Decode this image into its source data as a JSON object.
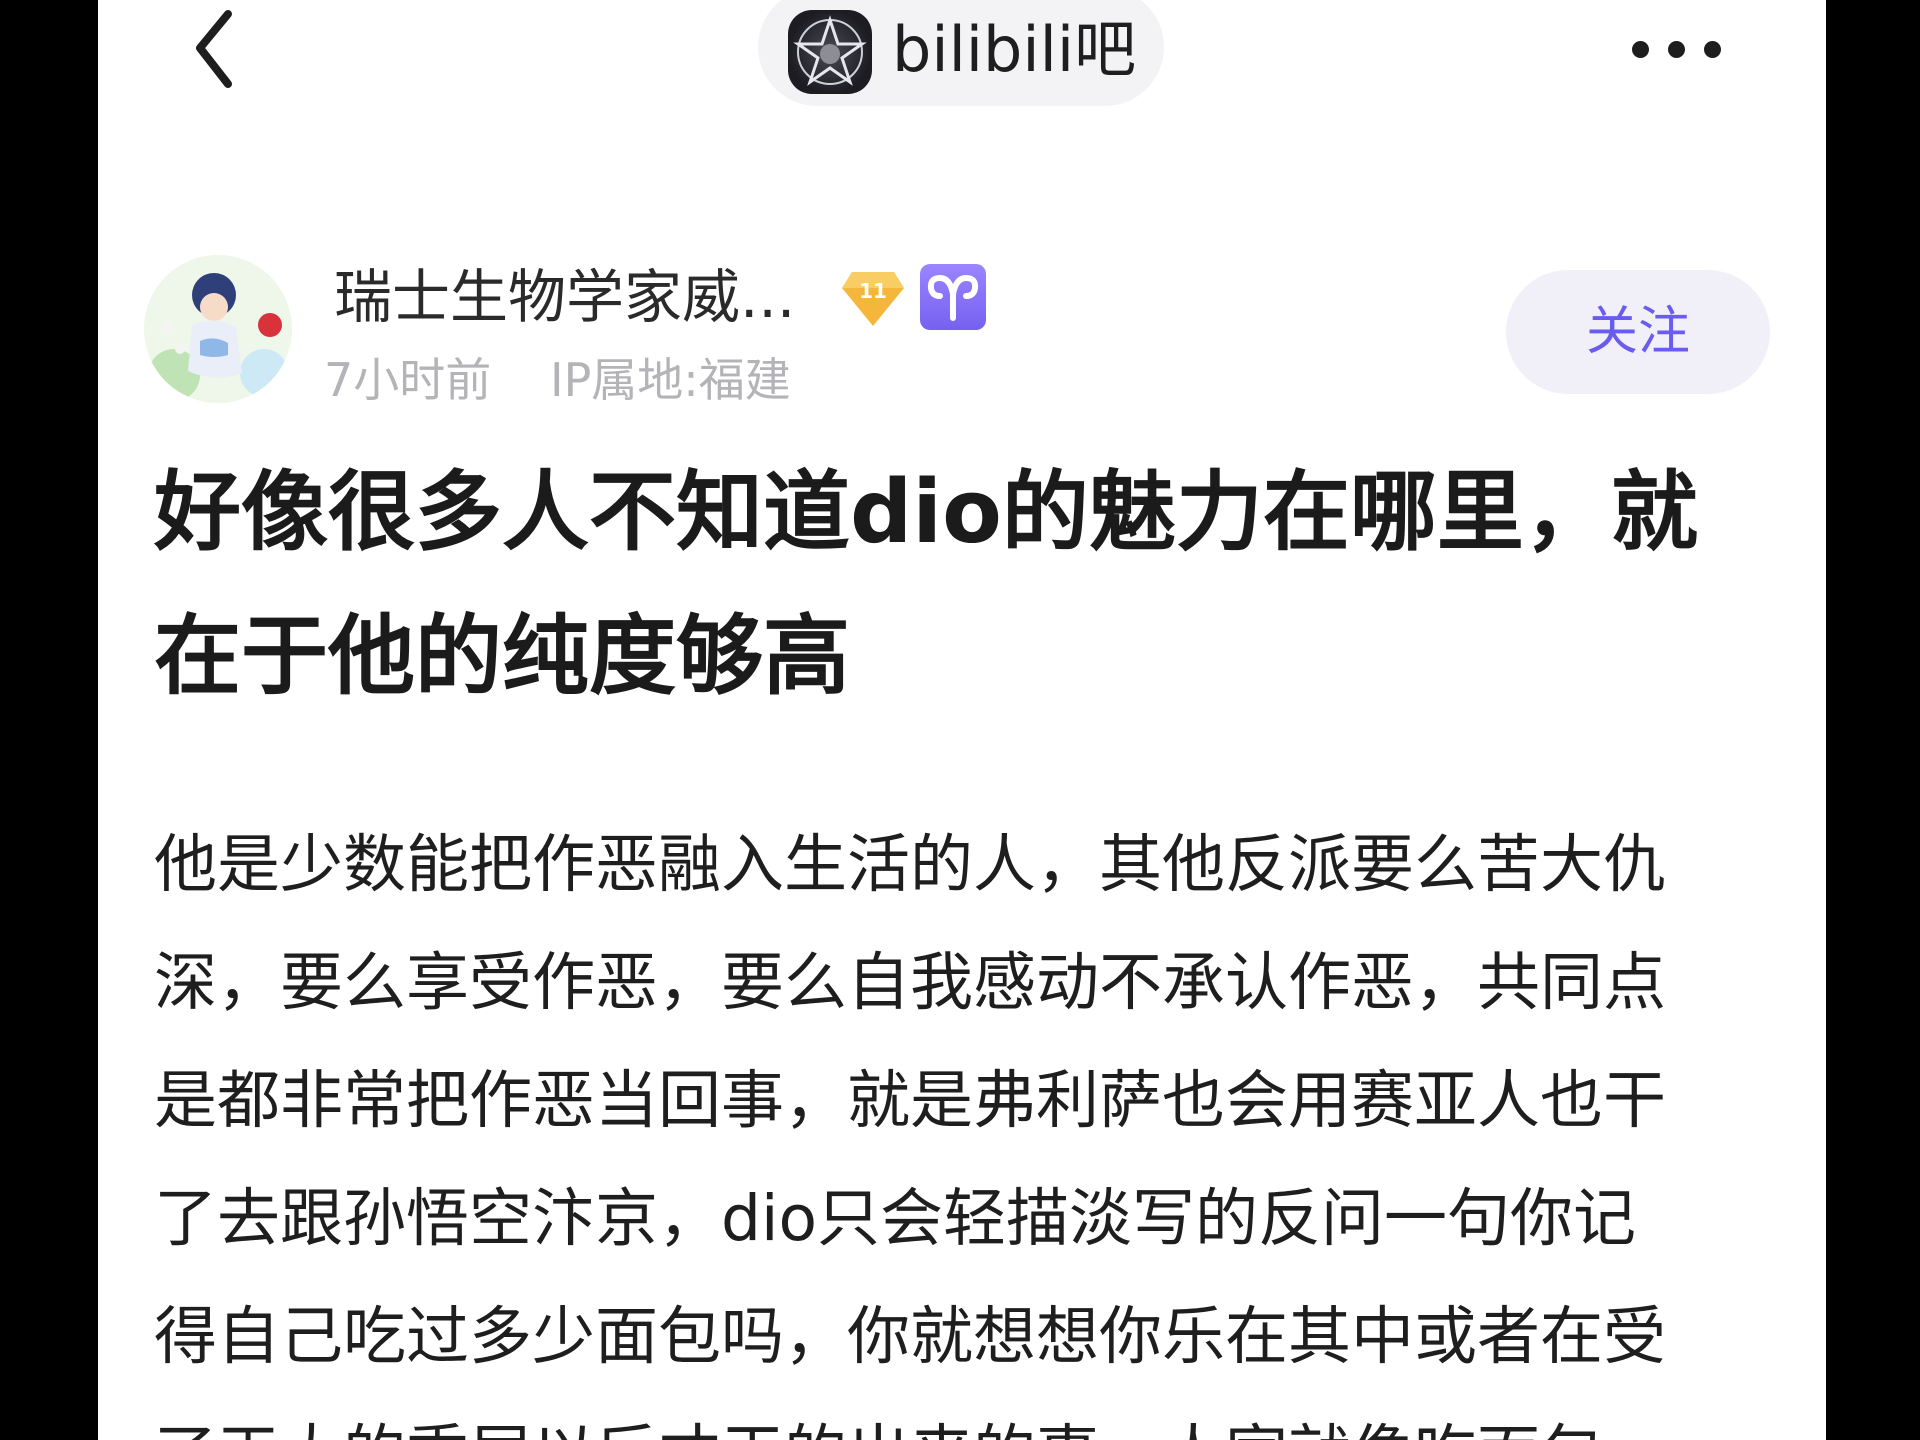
{
  "header": {
    "forum_name": "bilibili吧",
    "back_icon": "chevron-left-icon",
    "more_icon": "more-horizontal-icon"
  },
  "author": {
    "name": "瑞士生物学家威...",
    "level": "11",
    "zodiac_icon": "aries-icon",
    "zodiac_symbol": "♈",
    "time": "7小时前",
    "ip_location": "IP属地:福建",
    "follow_label": "关注"
  },
  "post": {
    "title_lines": [
      "好像很多人不知道dio的魅力在哪里，就",
      "在于他的纯度够高"
    ],
    "body_lines": [
      "他是少数能把作恶融入生活的人，其他反派要么苦大仇",
      "深，要么享受作恶，要么自我感动不承认作恶，共同点",
      "是都非常把作恶当回事，就是弗利萨也会用赛亚人也干",
      "了去跟孙悟空汴京，dio只会轻描淡写的反问一句你记",
      "得自己吃过多少面包吗，你就想想你乐在其中或者在受",
      "了天大的委屈以后才干的出来的事，人家就像吃面包"
    ]
  },
  "colors": {
    "accent": "#6b5cf0",
    "follow_bg": "#f1f0f8",
    "meta_text": "#b4b4b8",
    "level_badge": "#f5b73b",
    "zodiac_badge": "#7f6cf5"
  }
}
